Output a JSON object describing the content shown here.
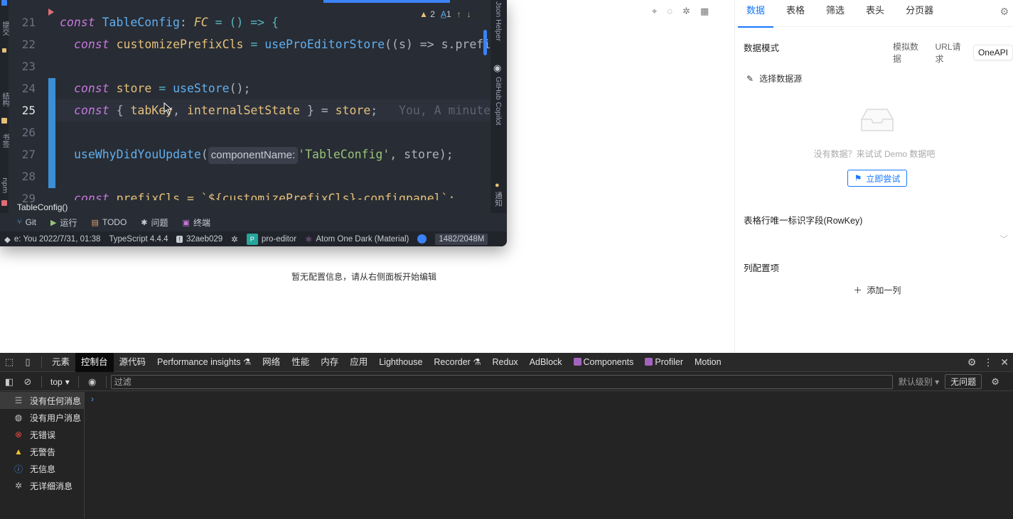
{
  "ide": {
    "left_strip_tabs": [
      "提交",
      "结构",
      "书签",
      "npm"
    ],
    "right_strip_tabs": [
      "Json Helper",
      "GitHub Copilot",
      "通知"
    ],
    "line_numbers": [
      "21",
      "22",
      "23",
      "24",
      "25",
      "26",
      "27",
      "28",
      "29"
    ],
    "toolbar": {
      "warnings": "2",
      "infos": "1"
    },
    "code": {
      "l21": {
        "kw": "const",
        "name": "TableConfig",
        "sep": ": ",
        "type": "FC",
        "rest": " = () => {"
      },
      "l22": {
        "kw": "const",
        "name": "customizePrefixCls",
        "eq": " = ",
        "fn": "useProEditorStore",
        "args": "((s) => s.prefi"
      },
      "l24": {
        "kw": "const",
        "name": "store",
        "eq": " = ",
        "fn": "useStore",
        "rest": "();"
      },
      "l25": {
        "kw": "const",
        "open": " { ",
        "a": "tabKey",
        "comma": ", ",
        "b": "internalSetState",
        "close": " } = ",
        "obj": "store",
        "semi": ";",
        "ghost": "You, A minute ago"
      },
      "l27": {
        "fn": "useWhyDidYouUpdate",
        "open": "(",
        "hint": "componentName:",
        "str": "'TableConfig'",
        "rest": ", store);"
      },
      "l29": {
        "kw": "const",
        "rest": " prefixCls = `${customizePrefixCls}-configpanel`;"
      }
    },
    "breadcrumb": "TableConfig()",
    "toolwindows": [
      {
        "icon": "git-branch-icon",
        "label": "Git"
      },
      {
        "icon": "run-icon",
        "label": "运行"
      },
      {
        "icon": "todo-icon",
        "label": "TODO"
      },
      {
        "icon": "problems-icon",
        "label": "问题"
      },
      {
        "icon": "terminal-icon",
        "label": "终端"
      }
    ],
    "status": {
      "blame": "e: You 2022/7/31, 01:38",
      "typescript": "TypeScript 4.4.4",
      "commit": "32aeb029",
      "project_badge": "P",
      "project": "pro-editor",
      "theme": "Atom One Dark (Material)",
      "memory": "1482/2048M"
    }
  },
  "main": {
    "empty_message": "暂无配置信息，请从右侧面板开始编辑"
  },
  "panel": {
    "tabs": [
      "数据",
      "表格",
      "筛选",
      "表头",
      "分页器"
    ],
    "active_tab": 0,
    "data_mode_label": "数据模式",
    "mode_options": [
      "模拟数据",
      "URL请求",
      "OneAPI"
    ],
    "select_source": "选择数据源",
    "no_data": "没有数据？来试试 Demo 数据吧",
    "try_button": "立即尝试",
    "rowkey_label": "表格行唯一标识字段(RowKey)",
    "columns_label": "列配置项",
    "add_column": "添加一列"
  },
  "devtools": {
    "tabs": [
      "元素",
      "控制台",
      "源代码",
      "Performance insights",
      "网络",
      "性能",
      "内存",
      "应用",
      "Lighthouse",
      "Recorder",
      "Redux",
      "AdBlock",
      "Components",
      "Profiler",
      "Motion"
    ],
    "active_tab": 1,
    "context": "top",
    "filter_placeholder": "过滤",
    "default_levels": "默认级别",
    "issues": "无问题",
    "sidebar": [
      {
        "icon": "list-icon",
        "label": "没有任何消息"
      },
      {
        "icon": "user-icon",
        "label": "没有用户消息"
      },
      {
        "icon": "error-icon",
        "label": "无错误"
      },
      {
        "icon": "warning-icon",
        "label": "无警告"
      },
      {
        "icon": "info-icon",
        "label": "无信息"
      },
      {
        "icon": "verbose-icon",
        "label": "无详细消息"
      }
    ]
  },
  "colors": {
    "accent": "#1677ff",
    "ide_bg": "#282c34",
    "devtools_bg": "#242424"
  }
}
